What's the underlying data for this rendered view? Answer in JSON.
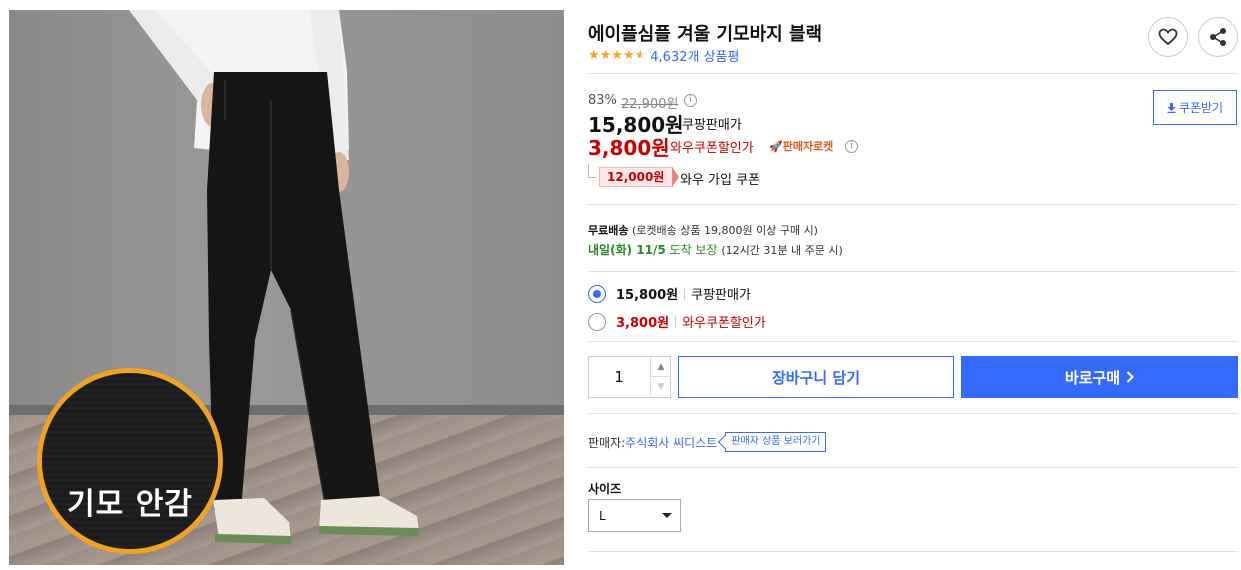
{
  "image": {
    "overlay_text": "기모 안감",
    "badge_color": "#f0a321"
  },
  "product": {
    "title": "에이플심플 겨울 기모바지 블랙",
    "rating": 4.5,
    "review_count": "4,632개 상품평"
  },
  "icons": {
    "wish": "heart-icon",
    "share": "share-icon",
    "info": "info-icon",
    "download": "download-icon",
    "rocket": "rocket-icon",
    "chevron": "chevron-right-icon"
  },
  "price": {
    "discount_rate": "83%",
    "original": "22,900원",
    "sale": "15,800원",
    "sale_label": "쿠팡판매가",
    "wow": "3,800원",
    "wow_label": "와우쿠폰할인가",
    "seller_rocket": "판매자로켓",
    "coupon_amount": "12,000원",
    "coupon_label": "와우 가입 쿠폰",
    "coupon_button": "쿠폰받기"
  },
  "shipping": {
    "free_label": "무료배송",
    "free_condition": "(로켓배송 상품 19,800원 이상 구매 시)",
    "arrival_day": "내일(화) 11/5",
    "arrival_text": "도착 보장",
    "arrival_cutoff": "(12시간 31분 내 주문 시)"
  },
  "options": [
    {
      "price": "15,800원",
      "label": "쿠팡판매가",
      "selected": true
    },
    {
      "price": "3,800원",
      "label": "와우쿠폰할인가",
      "selected": false
    }
  ],
  "purchase": {
    "quantity": "1",
    "cart_button": "장바구니 담기",
    "buy_button": "바로구매"
  },
  "seller": {
    "prefix": "판매자:",
    "name": "주식회사 씨디스트",
    "more_button": "판매자 상품 보러가기"
  },
  "size": {
    "label": "사이즈",
    "selected": "L"
  },
  "colors": {
    "accent": "#346aff",
    "wow_red": "#cc0000",
    "delivery_green": "#2a8a2a",
    "star": "#f6a623"
  }
}
